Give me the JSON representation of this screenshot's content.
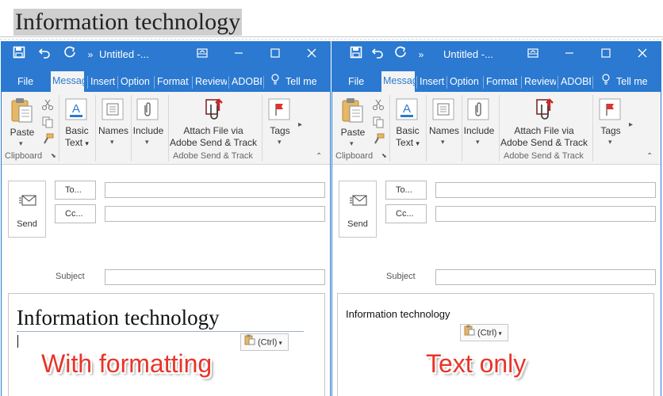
{
  "source": {
    "heading": "Information technology"
  },
  "windows": [
    {
      "title": "Untitled -...",
      "tabs": [
        "File",
        "Messag",
        "Insert",
        "Option",
        "Format",
        "Review",
        "ADOBE",
        "Tell me"
      ],
      "ribbon": {
        "paste": "Paste",
        "basic_text_1": "Basic",
        "basic_text_2": "Text",
        "names": "Names",
        "include": "Include",
        "attach_1": "Attach File via",
        "attach_2": "Adobe Send & Track",
        "tags": "Tags",
        "group_clipboard": "Clipboard",
        "group_adobe": "Adobe Send & Track"
      },
      "compose": {
        "send": "Send",
        "to": "To...",
        "cc": "Cc...",
        "subject": "Subject",
        "body_text": "Information technology",
        "paste_options": "(Ctrl)"
      },
      "caption": "With formatting"
    },
    {
      "title": "Untitled -...",
      "tabs": [
        "File",
        "Messag",
        "Insert",
        "Option",
        "Format",
        "Review",
        "ADOBE",
        "Tell me"
      ],
      "ribbon": {
        "paste": "Paste",
        "basic_text_1": "Basic",
        "basic_text_2": "Text",
        "names": "Names",
        "include": "Include",
        "attach_1": "Attach File via",
        "attach_2": "Adobe Send & Track",
        "tags": "Tags",
        "group_clipboard": "Clipboard",
        "group_adobe": "Adobe Send & Track"
      },
      "compose": {
        "send": "Send",
        "to": "To...",
        "cc": "Cc...",
        "subject": "Subject",
        "body_text": "Information technology",
        "paste_options": "(Ctrl)"
      },
      "caption": "Text only"
    }
  ],
  "colors": {
    "accent": "#2b79d0",
    "ribbon_bg": "#f3f3f3",
    "caption": "#e9342a"
  },
  "icons": {
    "save": "save-icon",
    "undo": "undo-icon",
    "redo": "redo-icon",
    "more": "more-commands-icon",
    "restore_ribbon": "ribbon-display-icon",
    "maximize": "maximize-icon",
    "close": "close-icon",
    "tell_me": "lightbulb-icon",
    "paste": "clipboard-paste-icon",
    "cut": "scissors-icon",
    "copy": "copy-icon",
    "format_painter": "format-painter-icon",
    "basic_text": "font-color-icon",
    "names": "address-book-icon",
    "include": "paperclip-icon",
    "attach": "adobe-attach-icon",
    "tags": "flag-icon",
    "send": "send-envelope-icon"
  }
}
